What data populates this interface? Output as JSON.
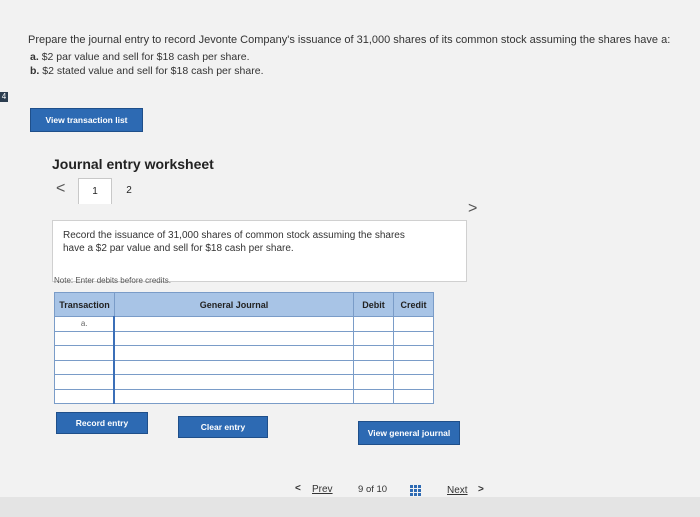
{
  "question": {
    "prompt": "Prepare the journal entry to record Jevonte Company's issuance of 31,000 shares of its common stock assuming the shares have a:",
    "options": [
      {
        "letter": "a.",
        "text": "$2 par value and sell for $18 cash per share."
      },
      {
        "letter": "b.",
        "text": "$2 stated value and sell for $18 cash per share."
      }
    ],
    "edge_marker": "4"
  },
  "buttons": {
    "view_transaction_list": "View transaction list",
    "record_entry": "Record entry",
    "clear_entry": "Clear entry",
    "view_general_journal": "View general journal"
  },
  "worksheet": {
    "title": "Journal entry worksheet",
    "tabs": [
      "1",
      "2"
    ],
    "prev_arrow": "<",
    "next_arrow": ">",
    "instruction_line1": "Record the issuance of 31,000 shares of common stock assuming the shares",
    "instruction_line2": "have a $2 par value and sell for $18 cash per share.",
    "note": "Note: Enter debits before credits.",
    "table": {
      "headers": [
        "Transaction",
        "General Journal",
        "Debit",
        "Credit"
      ],
      "rows": [
        [
          "a.",
          "",
          "",
          ""
        ],
        [
          "",
          "",
          "",
          ""
        ],
        [
          "",
          "",
          "",
          ""
        ],
        [
          "",
          "",
          "",
          ""
        ],
        [
          "",
          "",
          "",
          ""
        ],
        [
          "",
          "",
          "",
          ""
        ]
      ]
    }
  },
  "navigation": {
    "prev_icon": "<",
    "prev_label": "Prev",
    "current_page": "9",
    "of_label": "of",
    "total_pages": "10",
    "next_label": "Next",
    "next_icon": ">"
  },
  "colors": {
    "accent": "#2d6ab3",
    "table_header": "#a8c4e6",
    "background": "#f2f2f2"
  }
}
